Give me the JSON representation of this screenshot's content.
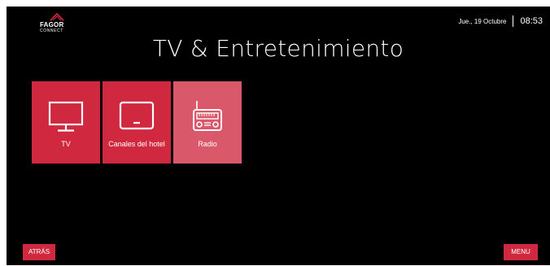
{
  "brand": {
    "name": "FAGOR",
    "sub": "CONNECT"
  },
  "header": {
    "date": "Jue., 19 Octubre",
    "time": "08:53"
  },
  "title": "TV & Entretenimiento",
  "tiles": [
    {
      "label": "TV",
      "icon": "tv-icon",
      "selected": false
    },
    {
      "label": "Canales del hotel",
      "icon": "tablet-tv-icon",
      "selected": false
    },
    {
      "label": "Radio",
      "icon": "radio-icon",
      "selected": true
    }
  ],
  "buttons": {
    "back": "ATRÁS",
    "menu": "MENU"
  },
  "colors": {
    "accent": "#d0293f",
    "accent_selected": "#d95869",
    "background": "#000000",
    "text": "#ffffff"
  }
}
